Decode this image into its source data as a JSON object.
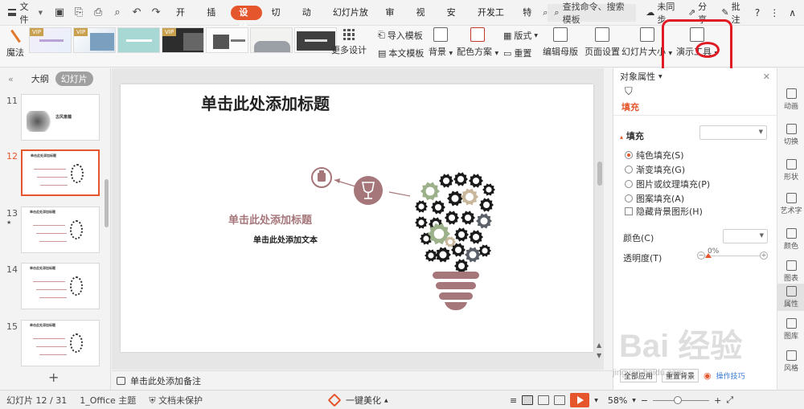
{
  "menubar": {
    "file_label": "文件",
    "tabs": [
      {
        "label": "开始"
      },
      {
        "label": "插入"
      },
      {
        "label": "设计",
        "active": true
      },
      {
        "label": "切换"
      },
      {
        "label": "动画"
      },
      {
        "label": "幻灯片放映"
      },
      {
        "label": "审阅"
      },
      {
        "label": "视图"
      },
      {
        "label": "安全"
      },
      {
        "label": "开发工具"
      },
      {
        "label": "特"
      }
    ],
    "search_placeholder": "查找命令、搜索模板",
    "sync_label": "未同步",
    "share_label": "分享",
    "annotate_label": "批注"
  },
  "ribbon": {
    "magic_label": "魔法",
    "vip_badge": "VIP",
    "more_design_label": "更多设计",
    "import_template_label": "导入模板",
    "this_template_label": "本文模板",
    "background_label": "背景",
    "color_scheme_label": "配色方案",
    "layout_label": "版式",
    "reset_label": "重置",
    "edit_master_label": "编辑母版",
    "page_setup_label": "页面设置",
    "slide_size_label": "幻灯片大小",
    "presentation_tools_label": "演示工具"
  },
  "left_panel": {
    "outline_tab": "大纲",
    "slides_tab": "幻灯片",
    "slides": [
      {
        "number": "11",
        "thumb_text": "古风意蕴"
      },
      {
        "number": "12",
        "thumb_text": "单击此处添加标题",
        "selected": true
      },
      {
        "number": "13",
        "thumb_text": "单击此处添加标题",
        "marker": "★"
      },
      {
        "number": "14",
        "thumb_text": "单击此处添加标题"
      },
      {
        "number": "15",
        "thumb_text": "单击此处添加标题"
      }
    ]
  },
  "slide": {
    "title": "单击此处添加标题",
    "subtitle": "单击此处添加标题",
    "body_text": "单击此处添加文本"
  },
  "property_panel": {
    "header": "对象属性",
    "tab": "填充",
    "section": "填充",
    "options": [
      {
        "label": "纯色填充(S)",
        "checked": true
      },
      {
        "label": "渐变填充(G)",
        "checked": false
      },
      {
        "label": "图片或纹理填充(P)",
        "checked": false
      },
      {
        "label": "图案填充(A)",
        "checked": false
      }
    ],
    "hide_bg_label": "隐藏背景图形(H)",
    "color_label": "颜色(C)",
    "transparency_label": "透明度(T)",
    "transparency_value": "0%",
    "apply_all_label": "全部应用",
    "reset_bg_label": "重置背景",
    "tips_label": "操作技巧"
  },
  "sidebar": {
    "items": [
      {
        "label": "动画"
      },
      {
        "label": "切换"
      },
      {
        "label": "形状"
      },
      {
        "label": "艺术字"
      },
      {
        "label": "颜色"
      },
      {
        "label": "图表"
      },
      {
        "label": "属性",
        "active": true
      },
      {
        "label": "图库"
      },
      {
        "label": "风格"
      }
    ]
  },
  "notes": {
    "placeholder": "单击此处添加备注"
  },
  "statusbar": {
    "slide_info": "幻灯片 12 / 31",
    "theme": "1_Office 主题",
    "protection": "文档未保护",
    "beautify": "一键美化",
    "zoom": "58%"
  },
  "watermark": {
    "text": "Bai 经验",
    "url": "jingyan.baidu.com"
  },
  "colors": {
    "accent": "#e5562c",
    "annotation": "#e01b26",
    "slide_pink": "#a5767a",
    "gear_sage": "#9cb08a",
    "gear_tan": "#c9b79b",
    "gear_slate": "#5b5f68"
  }
}
